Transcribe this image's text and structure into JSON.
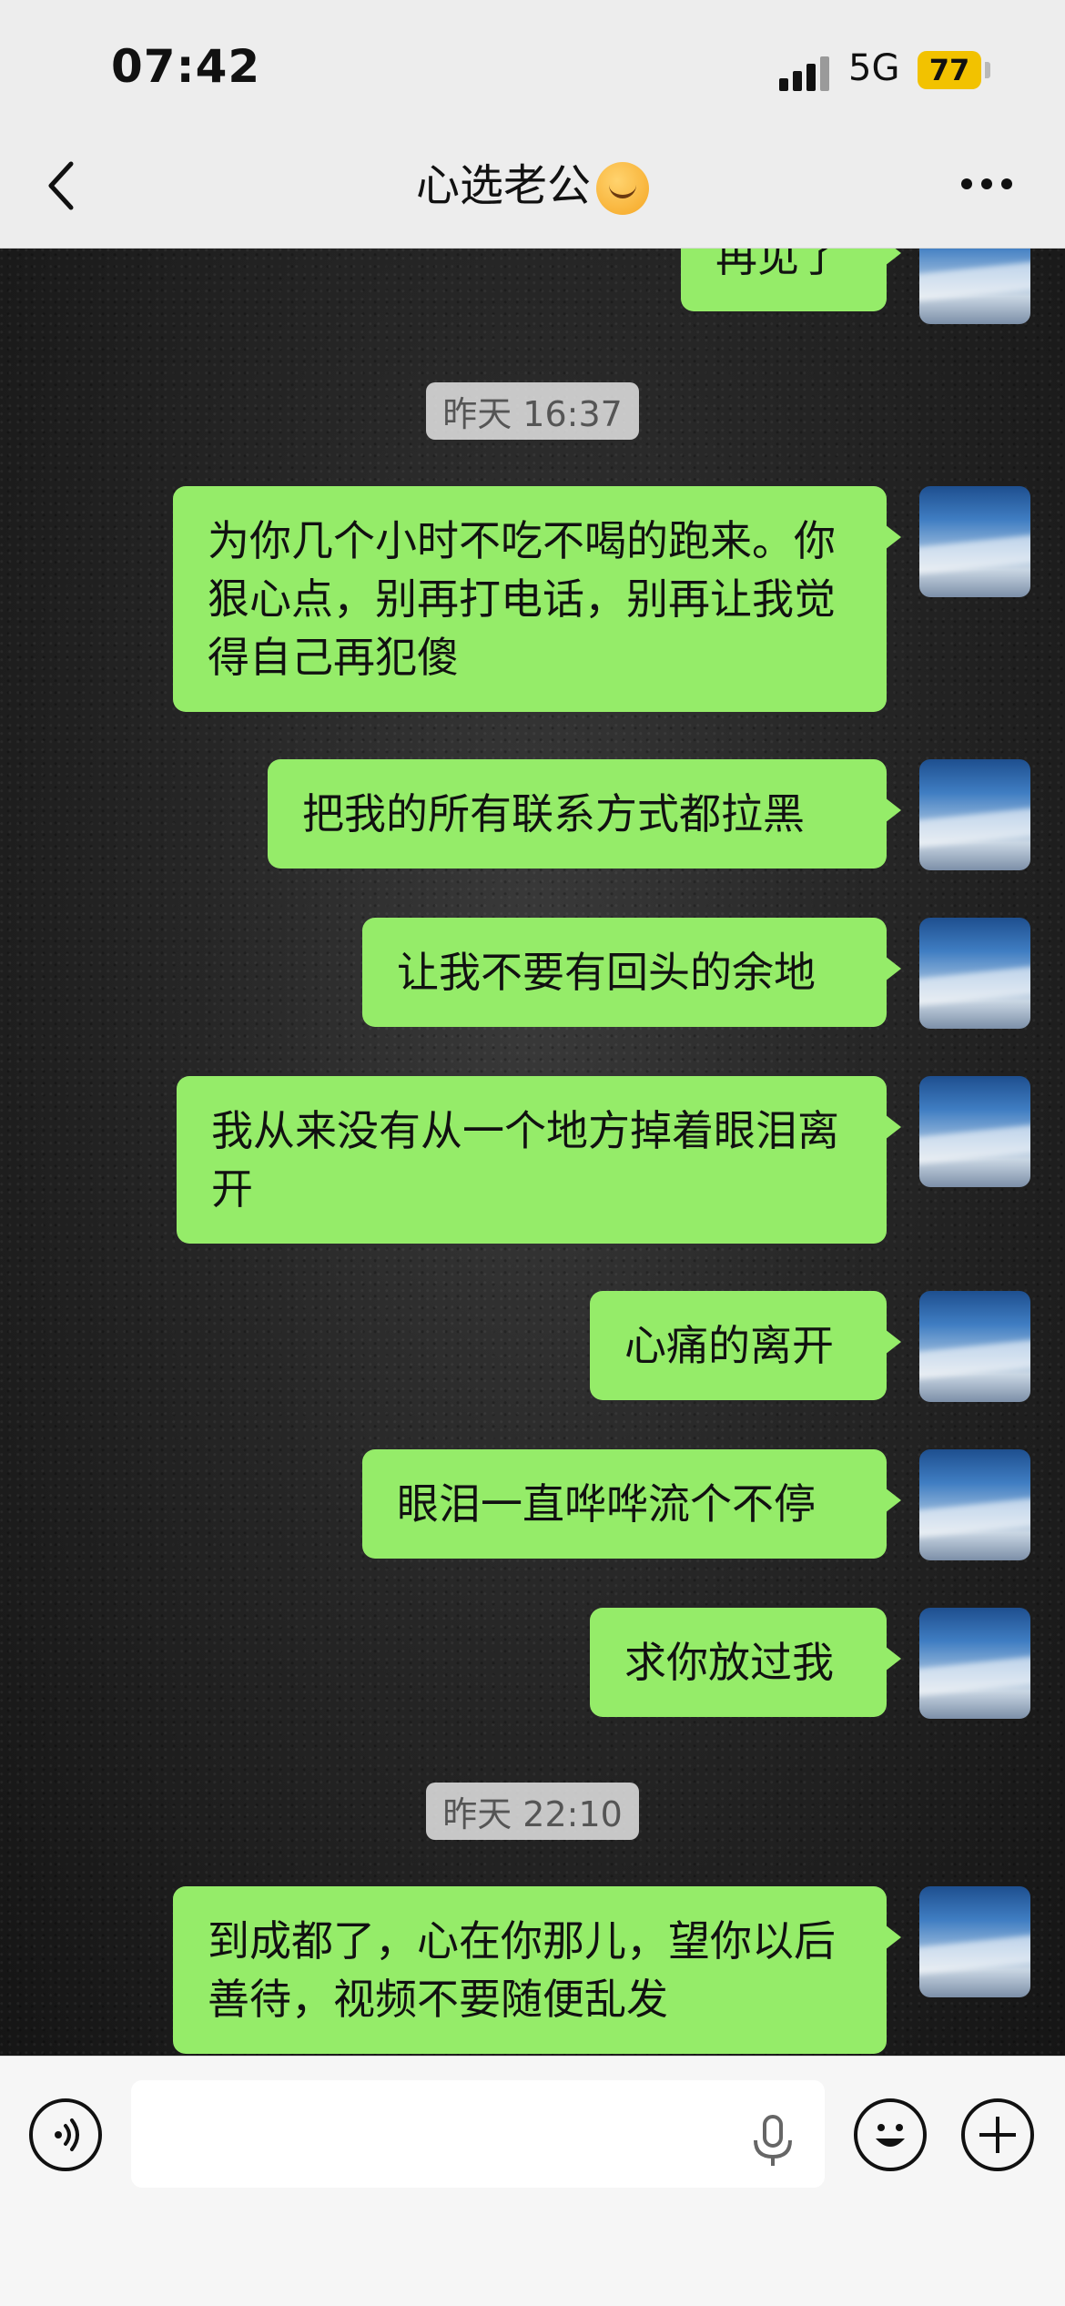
{
  "status": {
    "time": "07:42",
    "network": "5G",
    "battery": "77"
  },
  "nav": {
    "title": "心选老公",
    "back_label": "back",
    "more_label": "more"
  },
  "messages": [
    {
      "text": "再见了"
    },
    {
      "timestamp": "昨天 16:37"
    },
    {
      "text": "为你几个小时不吃不喝的跑来。你狠心点，别再打电话，别再让我觉得自己再犯傻"
    },
    {
      "text": "把我的所有联系方式都拉黑"
    },
    {
      "text": "让我不要有回头的余地"
    },
    {
      "text": "我从来没有从一个地方掉着眼泪离开"
    },
    {
      "text": "心痛的离开"
    },
    {
      "text": "眼泪一直哗哗流个不停"
    },
    {
      "text": "求你放过我"
    },
    {
      "timestamp": "昨天 22:10"
    },
    {
      "text": "到成都了，心在你那儿，望你以后善待，视频不要随便乱发"
    }
  ],
  "input": {
    "value": "",
    "placeholder": ""
  },
  "icons": {
    "voice": "voice-icon",
    "mic": "mic-icon",
    "emoji": "emoji-icon",
    "plus": "plus-icon",
    "back": "back-chevron-icon",
    "more": "more-dots-icon",
    "title_emoji": "smiling-hearts-emoji-icon"
  },
  "colors": {
    "bubble": "#95ec69",
    "bar": "#ededed",
    "accent_battery": "#f2c200"
  }
}
